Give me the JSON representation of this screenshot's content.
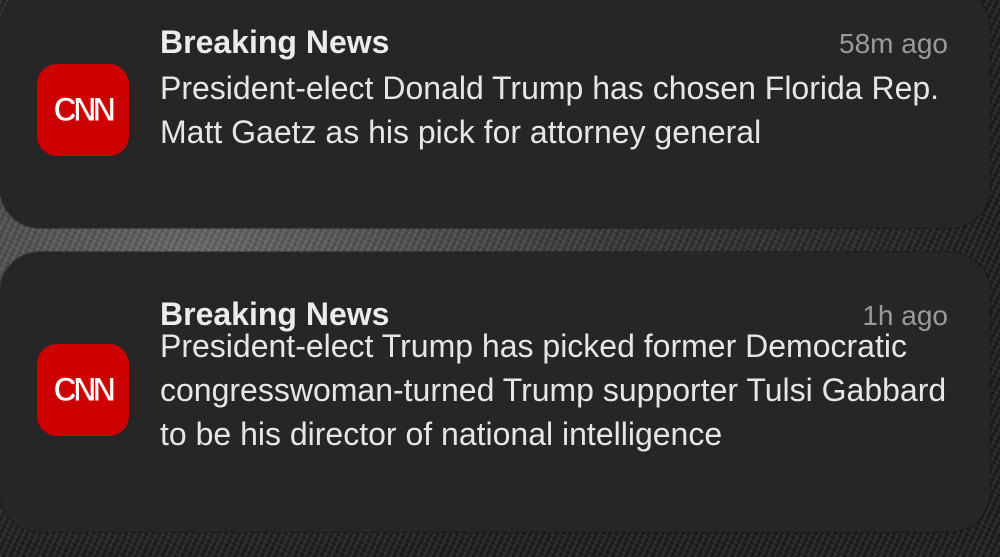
{
  "notifications": [
    {
      "app_icon": "cnn-logo-icon",
      "icon_text": "CNN",
      "icon_color": "#cc0000",
      "title": "Breaking News",
      "time": "58m ago",
      "body": "President-elect Donald Trump has chosen Florida Rep. Matt Gaetz as his pick for attorney general"
    },
    {
      "app_icon": "cnn-logo-icon",
      "icon_text": "CNN",
      "icon_color": "#cc0000",
      "title": "Breaking News",
      "time": "1h ago",
      "body": "President-elect Trump has picked former Democratic congresswoman-turned Trump supporter Tulsi Gabbard to be his director of national intelligence"
    }
  ]
}
